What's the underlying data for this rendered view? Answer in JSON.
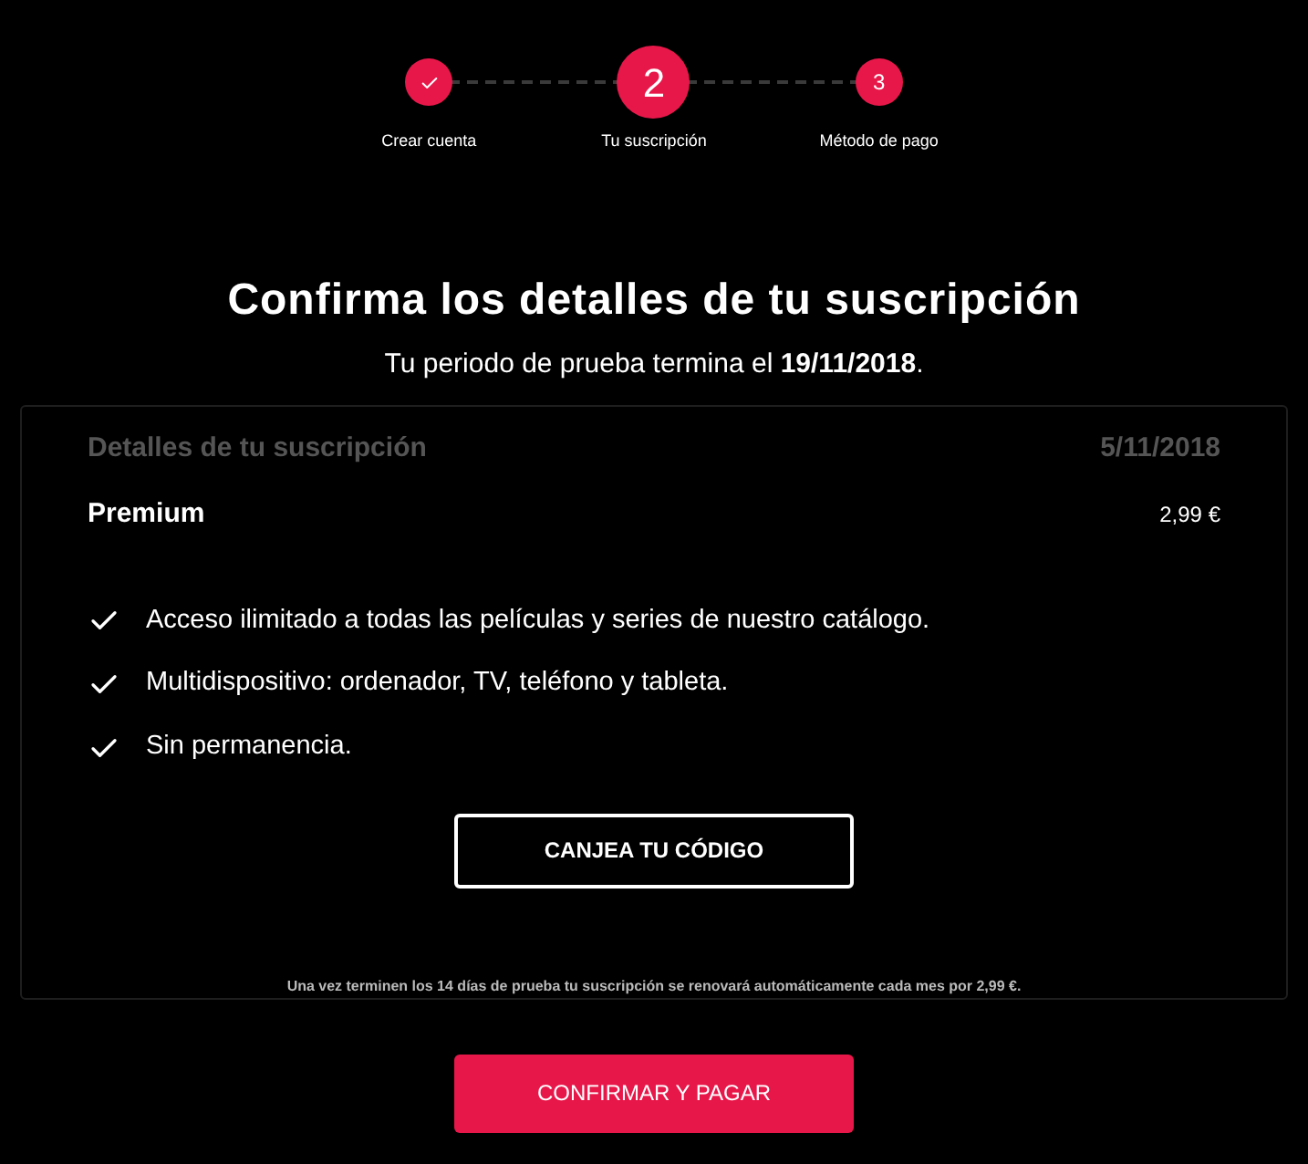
{
  "steps": [
    {
      "label": "Crear cuenta",
      "kind": "done"
    },
    {
      "label": "Tu suscripción",
      "number": "2",
      "kind": "current"
    },
    {
      "label": "Método de pago",
      "number": "3",
      "kind": "upcoming"
    }
  ],
  "title": "Confirma los detalles de tu suscripción",
  "subtitle": "Tu periodo de prueba termina el **19/11/2018**.",
  "details": {
    "heading": "Detalles de tu suscripción",
    "date": "5/11/2018",
    "plan": "Premium",
    "price": "2,99 €",
    "features": [
      "Acceso ilimitado a todas las películas y series de nuestro catálogo.",
      "Multidispositivo: ordenador, TV, teléfono y tableta.",
      "Sin permanencia."
    ],
    "code_button": "CANJEA TU CÓDIGO",
    "note": "Una vez terminen los 14 días de prueba tu suscripción se renovará automáticamente cada mes por 2,99 €."
  },
  "confirm_button": "CONFIRMAR Y PAGAR"
}
